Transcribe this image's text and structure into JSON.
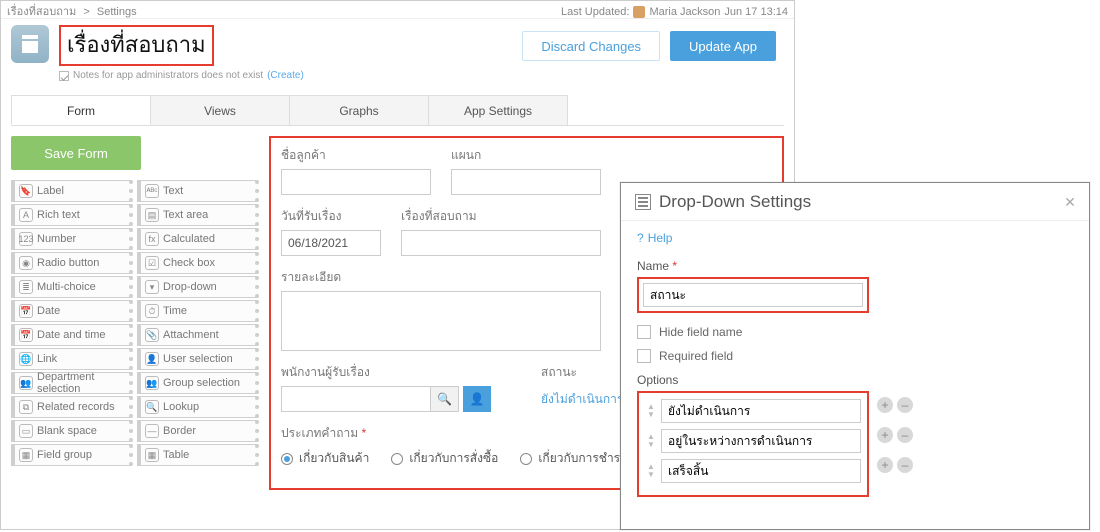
{
  "breadcrumb": {
    "app": "เรื่องที่สอบถาม",
    "sep": ">",
    "current": "Settings"
  },
  "last_updated": {
    "label": "Last Updated:",
    "user": "Maria Jackson",
    "time": "Jun 17 13:14"
  },
  "header": {
    "title": "เรื่องที่สอบถาม",
    "notes_text": "Notes for app administrators does not exist",
    "notes_create": "(Create)",
    "discard": "Discard Changes",
    "update": "Update App"
  },
  "tabs": {
    "form": "Form",
    "views": "Views",
    "graphs": "Graphs",
    "settings": "App Settings"
  },
  "save_form": "Save Form",
  "palette": {
    "left": [
      "Label",
      "Rich text",
      "Number",
      "Radio button",
      "Multi-choice",
      "Date",
      "Date and time",
      "Link",
      "Department selection",
      "Related records",
      "Blank space",
      "Field group"
    ],
    "right": [
      "Text",
      "Text area",
      "Calculated",
      "Check box",
      "Drop-down",
      "Time",
      "Attachment",
      "User selection",
      "Group selection",
      "Lookup",
      "Border",
      "Table"
    ]
  },
  "pal_icons": {
    "left": [
      "🔖",
      "A",
      "123",
      "◉",
      "≣",
      "📅",
      "📅",
      "🌐",
      "👥",
      "⧉",
      "▭",
      "▦"
    ],
    "right": [
      "ᴬᴮᶜ",
      "▤",
      "fx",
      "☑",
      "▾",
      "⏱",
      "📎",
      "👤",
      "👥",
      "🔍",
      "—",
      "▦"
    ]
  },
  "form": {
    "customer": "ชื่อลูกค้า",
    "dept": "แผนก",
    "date_label": "วันที่รับเรื่อง",
    "date_value": "06/18/2021",
    "subject": "เรื่องที่สอบถาม",
    "details": "รายละเอียด",
    "assignee": "พนักงานผู้รับเรื่อง",
    "status_label": "สถานะ",
    "status_value": "ยังไม่ดำเนินการ",
    "qtype_label": "ประเภทคำถาม",
    "qtype_opts": [
      "เกี่ยวกับสินค้า",
      "เกี่ยวกับการสั่งซื้อ",
      "เกี่ยวกับการชำระเงิน"
    ]
  },
  "panel": {
    "title": "Drop-Down Settings",
    "help": "Help",
    "name_label": "Name",
    "name_value": "สถานะ",
    "hide": "Hide field name",
    "required": "Required field",
    "options_label": "Options",
    "options": [
      "ยังไม่ดำเนินการ",
      "อยู่ในระหว่างการดำเนินการ",
      "เสร็จสิ้น"
    ]
  }
}
